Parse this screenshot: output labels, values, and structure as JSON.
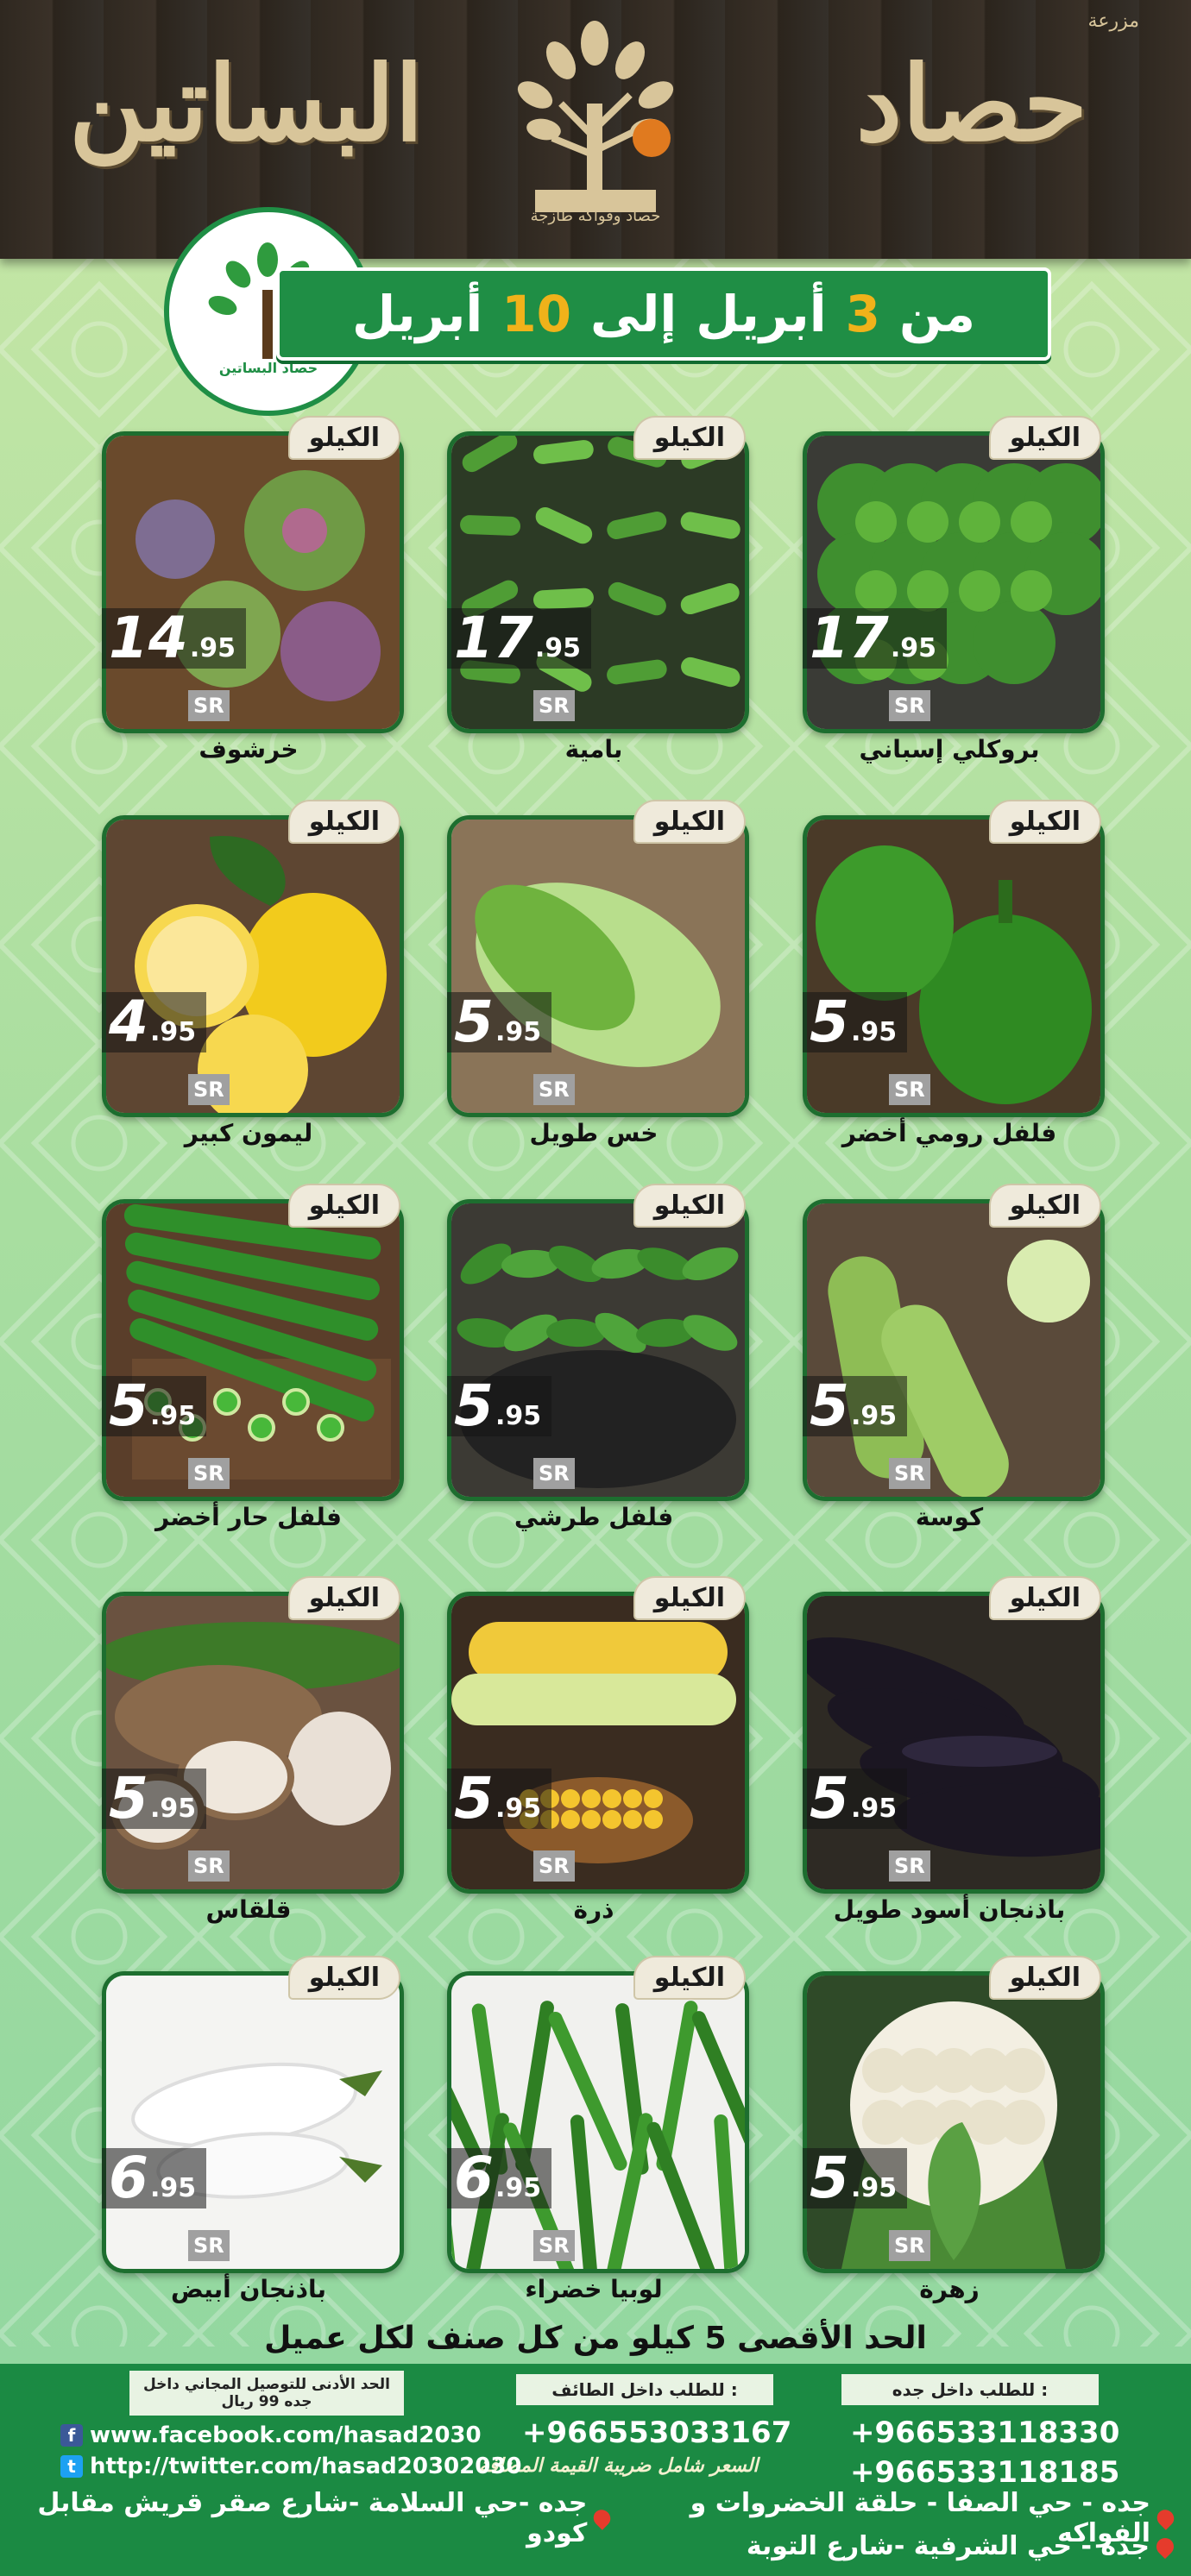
{
  "header": {
    "brand_small": "مزرعة",
    "brand_right": "حصاد",
    "brand_left": "البساتين",
    "logo_caption": "حصاد وفواكه طازجة"
  },
  "ribbon": {
    "from": "من",
    "start_day": "3",
    "start_month": "أبريل",
    "to": "إلى",
    "end_day": "10",
    "end_month": "أبريل"
  },
  "circle_logo_caption": "حصاد البساتين",
  "products": [
    {
      "name": "بروكلي إسباني",
      "unit": "الكيلو",
      "whole": "17",
      "dec": ".95",
      "currency": "SR",
      "img": "broccoli"
    },
    {
      "name": "بامية",
      "unit": "الكيلو",
      "whole": "17",
      "dec": ".95",
      "currency": "SR",
      "img": "okra"
    },
    {
      "name": "خرشوف",
      "unit": "الكيلو",
      "whole": "14",
      "dec": ".95",
      "currency": "SR",
      "img": "artichoke"
    },
    {
      "name": "فلفل رومي أخضر",
      "unit": "الكيلو",
      "whole": "5",
      "dec": ".95",
      "currency": "SR",
      "img": "pepper"
    },
    {
      "name": "خس طويل",
      "unit": "الكيلو",
      "whole": "5",
      "dec": ".95",
      "currency": "SR",
      "img": "lettuce"
    },
    {
      "name": "ليمون كبير",
      "unit": "الكيلو",
      "whole": "4",
      "dec": ".95",
      "currency": "SR",
      "img": "lemon"
    },
    {
      "name": "كوسة",
      "unit": "الكيلو",
      "whole": "5",
      "dec": ".95",
      "currency": "SR",
      "img": "zucchini"
    },
    {
      "name": "فلفل طرشي",
      "unit": "الكيلو",
      "whole": "5",
      "dec": ".95",
      "currency": "SR",
      "img": "padron"
    },
    {
      "name": "فلفل حار أخضر",
      "unit": "الكيلو",
      "whole": "5",
      "dec": ".95",
      "currency": "SR",
      "img": "chili"
    },
    {
      "name": "باذنجان أسود طويل",
      "unit": "الكيلو",
      "whole": "5",
      "dec": ".95",
      "currency": "SR",
      "img": "eggplant"
    },
    {
      "name": "ذرة",
      "unit": "الكيلو",
      "whole": "5",
      "dec": ".95",
      "currency": "SR",
      "img": "corn"
    },
    {
      "name": "قلقاس",
      "unit": "الكيلو",
      "whole": "5",
      "dec": ".95",
      "currency": "SR",
      "img": "taro"
    },
    {
      "name": "زهرة",
      "unit": "الكيلو",
      "whole": "5",
      "dec": ".95",
      "currency": "SR",
      "img": "cauliflower"
    },
    {
      "name": "لوبيا خضراء",
      "unit": "الكيلو",
      "whole": "6",
      "dec": ".95",
      "currency": "SR",
      "img": "beans"
    },
    {
      "name": "باذنجان أبيض",
      "unit": "الكيلو",
      "whole": "6",
      "dec": ".95",
      "currency": "SR",
      "img": "white-eggplant"
    }
  ],
  "limit_text": "الحد الأقصى 5 كيلو من كل صنف لكل عميل",
  "footer": {
    "jeddah_label": "للطلب داخل جده :",
    "jeddah_phone_1": "+966533118330",
    "jeddah_phone_2": "+966533118185",
    "taif_label": "للطلب داخل الطائف :",
    "taif_phone": "+966553033167",
    "vat_note": "السعر شامل ضريبة القيمة المضافة",
    "delivery_note": "الحد الأدنى للتوصيل المجاني داخل جده 99 ريال",
    "facebook": "www.facebook.com/hasad2030",
    "twitter": "http://twitter.com/hasad20302030",
    "address_1": "جده - حي الصفا - حلقة الخضروات و الفواكه",
    "address_2": "جده -حي السلامة -شارع صقر قريش مقابل كودو",
    "address_3": "جده - حي الشرفية -شارع التوبة"
  }
}
